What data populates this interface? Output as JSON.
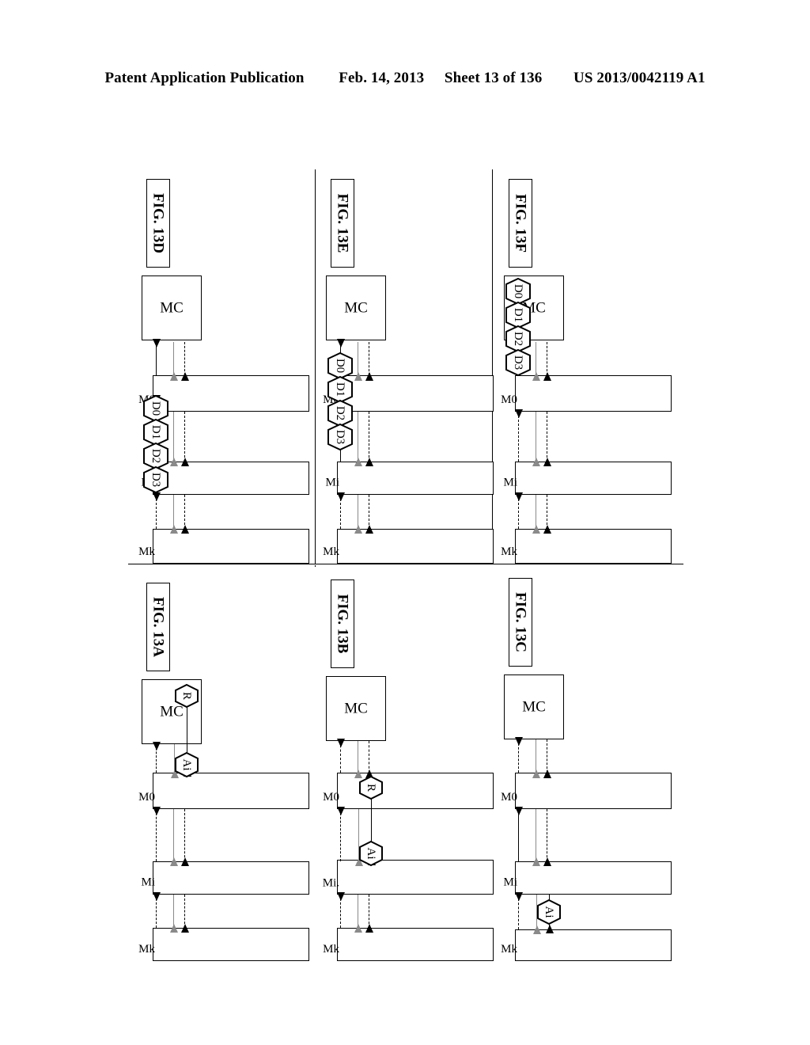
{
  "header": {
    "publication": "Patent Application Publication",
    "date": "Feb. 14, 2013",
    "sheet": "Sheet 13 of 136",
    "docnum": "US 2013/0042119 A1"
  },
  "colors": {
    "ink": "#000000",
    "gray_arrow": "#8a8a8a",
    "page_background": "#ffffff"
  },
  "node_labels": {
    "controller": "MC",
    "m0": "M0",
    "mi": "Mi",
    "mi_alt": "Mi.",
    "mk": "Mk"
  },
  "packets": {
    "d0": "D0",
    "d1": "D1",
    "d2": "D2",
    "d3": "D3",
    "r": "R",
    "ai": "Ai"
  },
  "panels": [
    {
      "id": "fig13d",
      "caption": "FIG. 13D",
      "row": "top",
      "column": 1,
      "boxes": [
        {
          "name": "mc",
          "label": "MC"
        },
        {
          "name": "m0",
          "label": "M0"
        },
        {
          "name": "mi",
          "label": "Mi"
        },
        {
          "name": "mk",
          "label": "Mk"
        }
      ],
      "hex_chain": {
        "labels": [
          "D0",
          "D1",
          "D2",
          "D3"
        ],
        "segment": "m0-to-mi"
      },
      "downstream_solid_from": "m0-to-mc"
    },
    {
      "id": "fig13e",
      "caption": "FIG. 13E",
      "row": "top",
      "column": 2,
      "boxes": [
        {
          "name": "mc",
          "label": "MC"
        },
        {
          "name": "m0",
          "label": "M0"
        },
        {
          "name": "mi",
          "label": "Mi"
        },
        {
          "name": "mk",
          "label": "Mk"
        }
      ],
      "hex_chain": {
        "labels": [
          "D0",
          "D1",
          "D2",
          "D3"
        ],
        "segment": "mi-to-mc"
      },
      "downstream_solid_from": "mi-to-mc"
    },
    {
      "id": "fig13f",
      "caption": "FIG. 13F",
      "row": "top",
      "column": 3,
      "boxes": [
        {
          "name": "mc",
          "label": "MC"
        },
        {
          "name": "m0",
          "label": "M0"
        },
        {
          "name": "mi",
          "label": "Mi"
        },
        {
          "name": "mk",
          "label": "Mk"
        }
      ],
      "hex_chain": {
        "labels": [
          "D0",
          "D1",
          "D2",
          "D3"
        ],
        "segment": "m0-to-mc"
      },
      "downstream_solid_from": "m0-to-mc"
    },
    {
      "id": "fig13a",
      "caption": "FIG. 13A",
      "row": "bottom",
      "column": 1,
      "boxes": [
        {
          "name": "mc",
          "label": "MC"
        },
        {
          "name": "m0",
          "label": "M0"
        },
        {
          "name": "mi",
          "label": "Mi"
        },
        {
          "name": "mk",
          "label": "Mk"
        }
      ],
      "hex_single": [
        {
          "label": "R",
          "at": "mc"
        },
        {
          "label": "Ai",
          "at": "m0"
        }
      ]
    },
    {
      "id": "fig13b",
      "caption": "FIG. 13B",
      "row": "bottom",
      "column": 2,
      "boxes": [
        {
          "name": "mc",
          "label": "MC"
        },
        {
          "name": "m0",
          "label": "M0"
        },
        {
          "name": "mi",
          "label": "Mi."
        },
        {
          "name": "mk",
          "label": "Mk"
        }
      ],
      "hex_single": [
        {
          "label": "R",
          "at": "m0"
        },
        {
          "label": "Ai",
          "at": "mi"
        }
      ]
    },
    {
      "id": "fig13c",
      "caption": "FIG. 13C",
      "row": "bottom",
      "column": 3,
      "boxes": [
        {
          "name": "mc",
          "label": "MC"
        },
        {
          "name": "m0",
          "label": "M0"
        },
        {
          "name": "mi",
          "label": "Mi"
        },
        {
          "name": "mk",
          "label": "Mk"
        }
      ],
      "hex_single": [
        {
          "label": "Ai",
          "at": "mk"
        }
      ],
      "downstream_solid_from": "mi-to-m0"
    }
  ]
}
